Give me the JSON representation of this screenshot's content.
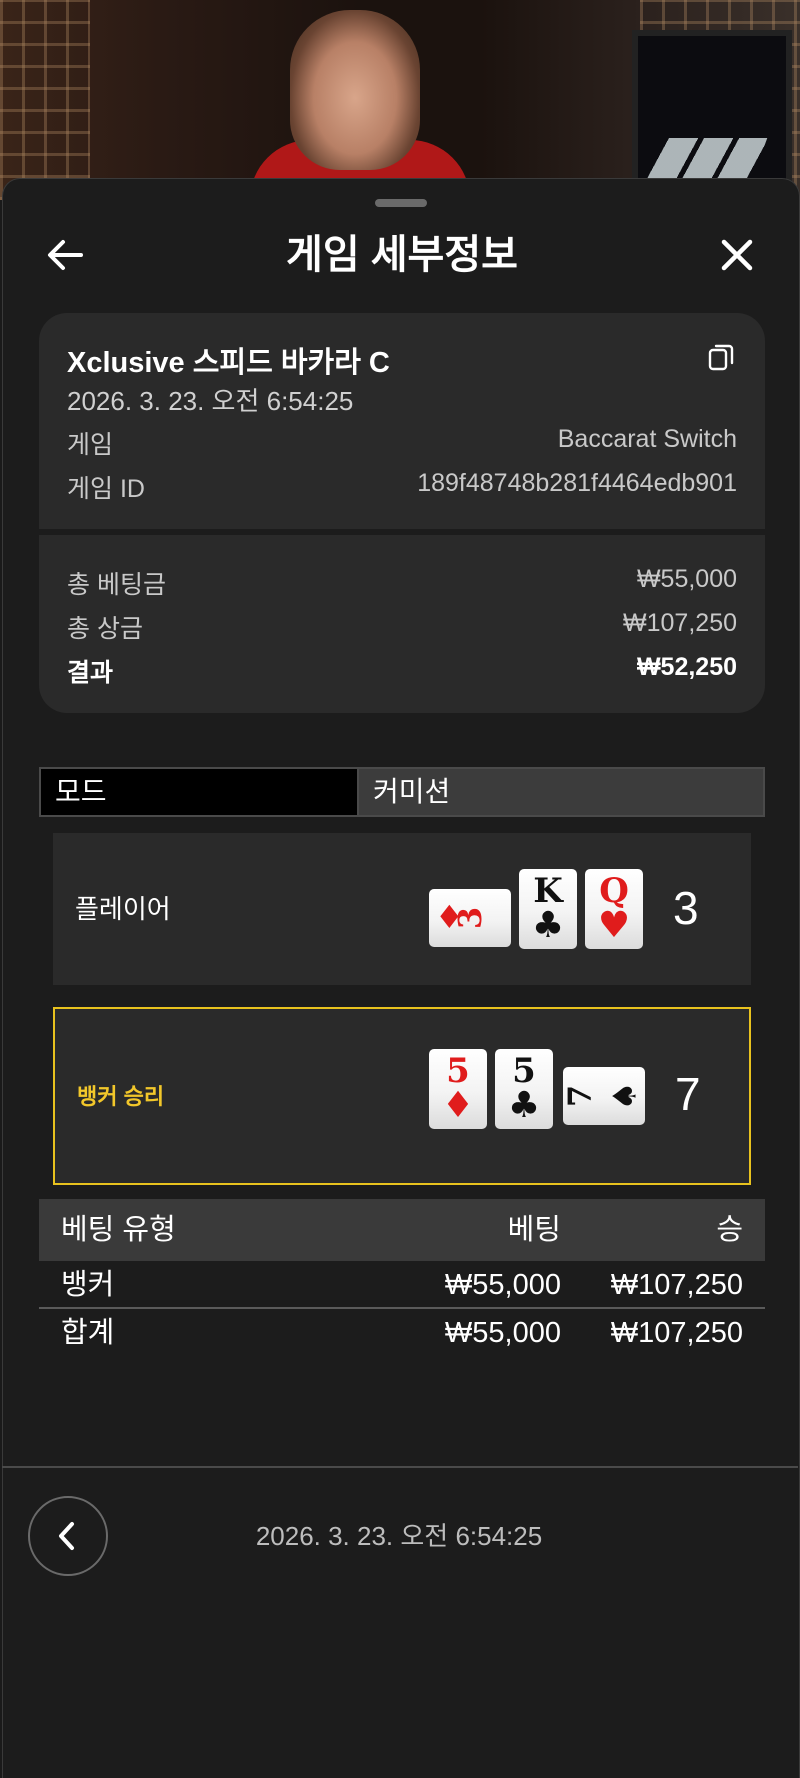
{
  "header": {
    "title": "게임 세부정보",
    "back_icon": "arrow-left-icon",
    "close_icon": "close-icon"
  },
  "game_info": {
    "name": "Xclusive 스피드 바카라 C",
    "datetime": "2026. 3. 23. 오전 6:54:25",
    "copy_icon": "copy-icon",
    "game_label": "게임",
    "game_value": "Baccarat Switch",
    "game_id_label": "게임 ID",
    "game_id_value": "189f48748b281f4464edb901"
  },
  "summary": {
    "total_bet_label": "총 베팅금",
    "total_bet_value": "₩55,000",
    "total_win_label": "총 상금",
    "total_win_value": "₩107,250",
    "result_label": "결과",
    "result_value": "₩52,250"
  },
  "tabs": [
    {
      "label": "모드",
      "active": true
    },
    {
      "label": "커미션",
      "active": false
    }
  ],
  "hands": {
    "player": {
      "label": "플레이어",
      "score": "3",
      "cards": [
        {
          "rank": "3",
          "suit": "♦",
          "color": "red",
          "orientation": "sideways"
        },
        {
          "rank": "K",
          "suit": "♣",
          "color": "black",
          "orientation": "upright"
        },
        {
          "rank": "Q",
          "suit": "♥",
          "color": "red",
          "orientation": "upright"
        }
      ]
    },
    "banker": {
      "label": "뱅커 승리",
      "score": "7",
      "cards": [
        {
          "rank": "5",
          "suit": "♦",
          "color": "red",
          "orientation": "upright"
        },
        {
          "rank": "5",
          "suit": "♣",
          "color": "black",
          "orientation": "upright"
        },
        {
          "rank": "7",
          "suit": "♠",
          "color": "black",
          "orientation": "sideways"
        }
      ]
    },
    "winner_highlight_color": "#e8c21e"
  },
  "bet_table": {
    "headers": {
      "type": "베팅 유형",
      "bet": "베팅",
      "win": "승"
    },
    "rows": [
      {
        "type": "뱅커",
        "bet": "₩55,000",
        "win": "₩107,250"
      }
    ],
    "total": {
      "type": "합계",
      "bet": "₩55,000",
      "win": "₩107,250"
    }
  },
  "footer": {
    "back_icon": "chevron-left-icon",
    "datetime": "2026. 3. 23. 오전 6:54:25"
  }
}
